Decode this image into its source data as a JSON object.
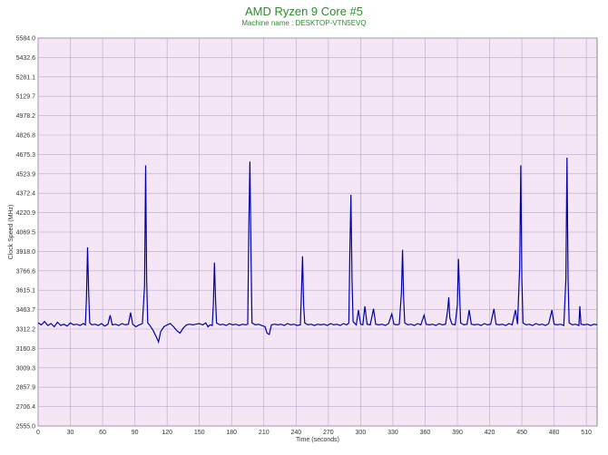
{
  "chart_data": {
    "type": "line",
    "title": "AMD Ryzen 9 Core #5",
    "subtitle": "Machine name : DESKTOP-VTN5EVQ",
    "xlabel": "Time (seconds)",
    "ylabel": "Clock Speed (MHz)",
    "xlim": [
      0,
      520
    ],
    "ylim": [
      2555.0,
      5584.0
    ],
    "x_ticks": [
      "0",
      "30",
      "60",
      "90",
      "120",
      "150",
      "180",
      "210",
      "240",
      "270",
      "300",
      "330",
      "360",
      "390",
      "420",
      "450",
      "480",
      "510"
    ],
    "y_ticks": [
      "5584.0",
      "5432.6",
      "5281.1",
      "5129.7",
      "4978.2",
      "4826.8",
      "4675.3",
      "4523.9",
      "4372.4",
      "4220.9",
      "4069.5",
      "3918.0",
      "3766.6",
      "3615.1",
      "3463.7",
      "3312.2",
      "3160.8",
      "3009.3",
      "2857.9",
      "2706.4",
      "2555.0"
    ],
    "grid": true,
    "background_color": "#f5e6f5",
    "line_color": "#0000aa",
    "series": [
      {
        "values": [
          [
            0,
            3360
          ],
          [
            3,
            3345
          ],
          [
            6,
            3370
          ],
          [
            9,
            3340
          ],
          [
            12,
            3355
          ],
          [
            15,
            3330
          ],
          [
            18,
            3365
          ],
          [
            21,
            3340
          ],
          [
            24,
            3350
          ],
          [
            27,
            3335
          ],
          [
            30,
            3360
          ],
          [
            33,
            3345
          ],
          [
            36,
            3350
          ],
          [
            39,
            3340
          ],
          [
            42,
            3355
          ],
          [
            44,
            3345
          ],
          [
            45,
            3560
          ],
          [
            46,
            3950
          ],
          [
            47,
            3600
          ],
          [
            48,
            3360
          ],
          [
            50,
            3345
          ],
          [
            53,
            3350
          ],
          [
            56,
            3340
          ],
          [
            59,
            3355
          ],
          [
            62,
            3335
          ],
          [
            65,
            3350
          ],
          [
            67,
            3420
          ],
          [
            69,
            3345
          ],
          [
            72,
            3350
          ],
          [
            75,
            3340
          ],
          [
            78,
            3355
          ],
          [
            81,
            3345
          ],
          [
            84,
            3350
          ],
          [
            86,
            3440
          ],
          [
            88,
            3350
          ],
          [
            91,
            3330
          ],
          [
            94,
            3345
          ],
          [
            97,
            3355
          ],
          [
            99,
            3650
          ],
          [
            100,
            4590
          ],
          [
            101,
            3700
          ],
          [
            102,
            3360
          ],
          [
            104,
            3340
          ],
          [
            107,
            3300
          ],
          [
            110,
            3250
          ],
          [
            112,
            3210
          ],
          [
            114,
            3290
          ],
          [
            117,
            3330
          ],
          [
            120,
            3345
          ],
          [
            123,
            3355
          ],
          [
            126,
            3330
          ],
          [
            129,
            3300
          ],
          [
            132,
            3280
          ],
          [
            135,
            3320
          ],
          [
            138,
            3345
          ],
          [
            141,
            3350
          ],
          [
            144,
            3345
          ],
          [
            147,
            3350
          ],
          [
            150,
            3355
          ],
          [
            153,
            3345
          ],
          [
            156,
            3360
          ],
          [
            158,
            3330
          ],
          [
            160,
            3345
          ],
          [
            162,
            3340
          ],
          [
            163,
            3500
          ],
          [
            164,
            3830
          ],
          [
            165,
            3550
          ],
          [
            166,
            3360
          ],
          [
            169,
            3345
          ],
          [
            172,
            3350
          ],
          [
            175,
            3340
          ],
          [
            178,
            3355
          ],
          [
            181,
            3345
          ],
          [
            184,
            3350
          ],
          [
            187,
            3340
          ],
          [
            190,
            3350
          ],
          [
            193,
            3345
          ],
          [
            195,
            3350
          ],
          [
            196,
            4100
          ],
          [
            197,
            4620
          ],
          [
            198,
            3900
          ],
          [
            199,
            3360
          ],
          [
            202,
            3345
          ],
          [
            205,
            3350
          ],
          [
            208,
            3340
          ],
          [
            211,
            3330
          ],
          [
            213,
            3280
          ],
          [
            215,
            3270
          ],
          [
            217,
            3345
          ],
          [
            220,
            3350
          ],
          [
            223,
            3345
          ],
          [
            226,
            3350
          ],
          [
            229,
            3340
          ],
          [
            232,
            3355
          ],
          [
            235,
            3345
          ],
          [
            238,
            3350
          ],
          [
            241,
            3340
          ],
          [
            244,
            3345
          ],
          [
            245,
            3600
          ],
          [
            246,
            3880
          ],
          [
            247,
            3500
          ],
          [
            248,
            3360
          ],
          [
            251,
            3345
          ],
          [
            254,
            3350
          ],
          [
            257,
            3340
          ],
          [
            260,
            3350
          ],
          [
            263,
            3345
          ],
          [
            266,
            3350
          ],
          [
            269,
            3340
          ],
          [
            272,
            3355
          ],
          [
            275,
            3345
          ],
          [
            278,
            3350
          ],
          [
            281,
            3340
          ],
          [
            284,
            3355
          ],
          [
            287,
            3345
          ],
          [
            289,
            3360
          ],
          [
            290,
            3900
          ],
          [
            291,
            4360
          ],
          [
            292,
            3700
          ],
          [
            293,
            3370
          ],
          [
            296,
            3345
          ],
          [
            298,
            3460
          ],
          [
            300,
            3350
          ],
          [
            302,
            3345
          ],
          [
            304,
            3490
          ],
          [
            306,
            3350
          ],
          [
            309,
            3345
          ],
          [
            312,
            3470
          ],
          [
            314,
            3350
          ],
          [
            317,
            3345
          ],
          [
            320,
            3350
          ],
          [
            323,
            3340
          ],
          [
            326,
            3355
          ],
          [
            329,
            3430
          ],
          [
            331,
            3350
          ],
          [
            334,
            3345
          ],
          [
            336,
            3350
          ],
          [
            338,
            3600
          ],
          [
            339,
            3930
          ],
          [
            340,
            3550
          ],
          [
            341,
            3360
          ],
          [
            344,
            3345
          ],
          [
            347,
            3350
          ],
          [
            350,
            3340
          ],
          [
            353,
            3355
          ],
          [
            356,
            3345
          ],
          [
            359,
            3420
          ],
          [
            361,
            3350
          ],
          [
            364,
            3345
          ],
          [
            367,
            3350
          ],
          [
            370,
            3340
          ],
          [
            373,
            3355
          ],
          [
            376,
            3345
          ],
          [
            379,
            3350
          ],
          [
            381,
            3460
          ],
          [
            382,
            3560
          ],
          [
            383,
            3400
          ],
          [
            385,
            3350
          ],
          [
            388,
            3345
          ],
          [
            390,
            3500
          ],
          [
            391,
            3860
          ],
          [
            392,
            3600
          ],
          [
            393,
            3360
          ],
          [
            396,
            3345
          ],
          [
            399,
            3350
          ],
          [
            401,
            3460
          ],
          [
            403,
            3350
          ],
          [
            406,
            3345
          ],
          [
            409,
            3350
          ],
          [
            412,
            3340
          ],
          [
            415,
            3355
          ],
          [
            418,
            3345
          ],
          [
            421,
            3350
          ],
          [
            424,
            3470
          ],
          [
            426,
            3350
          ],
          [
            429,
            3345
          ],
          [
            432,
            3350
          ],
          [
            435,
            3340
          ],
          [
            438,
            3355
          ],
          [
            441,
            3345
          ],
          [
            444,
            3460
          ],
          [
            446,
            3350
          ],
          [
            448,
            3800
          ],
          [
            449,
            4590
          ],
          [
            450,
            3700
          ],
          [
            451,
            3360
          ],
          [
            454,
            3345
          ],
          [
            457,
            3350
          ],
          [
            460,
            3340
          ],
          [
            463,
            3355
          ],
          [
            466,
            3345
          ],
          [
            469,
            3350
          ],
          [
            472,
            3340
          ],
          [
            475,
            3355
          ],
          [
            478,
            3460
          ],
          [
            480,
            3350
          ],
          [
            483,
            3345
          ],
          [
            486,
            3350
          ],
          [
            489,
            3340
          ],
          [
            491,
            3700
          ],
          [
            492,
            4650
          ],
          [
            493,
            3700
          ],
          [
            494,
            3360
          ],
          [
            497,
            3345
          ],
          [
            500,
            3350
          ],
          [
            503,
            3340
          ],
          [
            504,
            3490
          ],
          [
            505,
            3350
          ],
          [
            508,
            3345
          ],
          [
            511,
            3350
          ],
          [
            514,
            3340
          ],
          [
            517,
            3350
          ],
          [
            520,
            3345
          ]
        ]
      }
    ]
  }
}
